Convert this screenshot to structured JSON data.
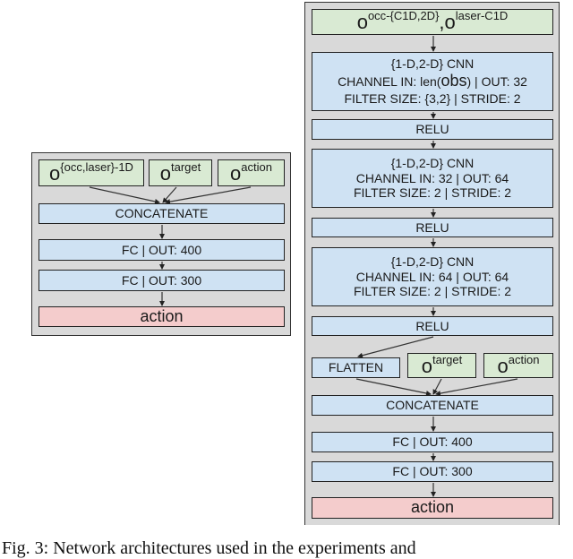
{
  "left_network": {
    "inputs": [
      {
        "base": "o",
        "sup": "{occ,laser}-1D"
      },
      {
        "base": "o",
        "sup": "target"
      },
      {
        "base": "o",
        "sup": "action"
      }
    ],
    "concat": "CONCATENATE",
    "fc1": "FC | OUT: 400",
    "fc2": "FC | OUT: 300",
    "output": "action"
  },
  "right_network": {
    "input": {
      "base1": "o",
      "sup1": "occ-{C1D,2D}",
      "sep": ",",
      "base2": "o",
      "sup2": "laser-C1D"
    },
    "cnn1": {
      "title": "{1-D,2-D} CNN",
      "channel_prefix": "CHANNEL IN: len(",
      "channel_obs": "obs",
      "channel_suffix": ") | OUT: 32",
      "filter": "FILTER SIZE: {3,2} | STRIDE: 2"
    },
    "relu1": "RELU",
    "cnn2": {
      "title": "{1-D,2-D} CNN",
      "channel": "CHANNEL IN: 32 | OUT: 64",
      "filter": "FILTER SIZE: 2 | STRIDE: 2"
    },
    "relu2": "RELU",
    "cnn3": {
      "title": "{1-D,2-D} CNN",
      "channel": "CHANNEL IN: 64 | OUT: 64",
      "filter": "FILTER SIZE: 2 | STRIDE: 2"
    },
    "relu3": "RELU",
    "flatten": "FLATTEN",
    "target": {
      "base": "o",
      "sup": "target"
    },
    "action_in": {
      "base": "o",
      "sup": "action"
    },
    "concat": "CONCATENATE",
    "fc1": "FC | OUT: 400",
    "fc2": "FC | OUT: 300",
    "output": "action"
  },
  "caption": "Fig. 3: Network architectures used in the experiments and"
}
